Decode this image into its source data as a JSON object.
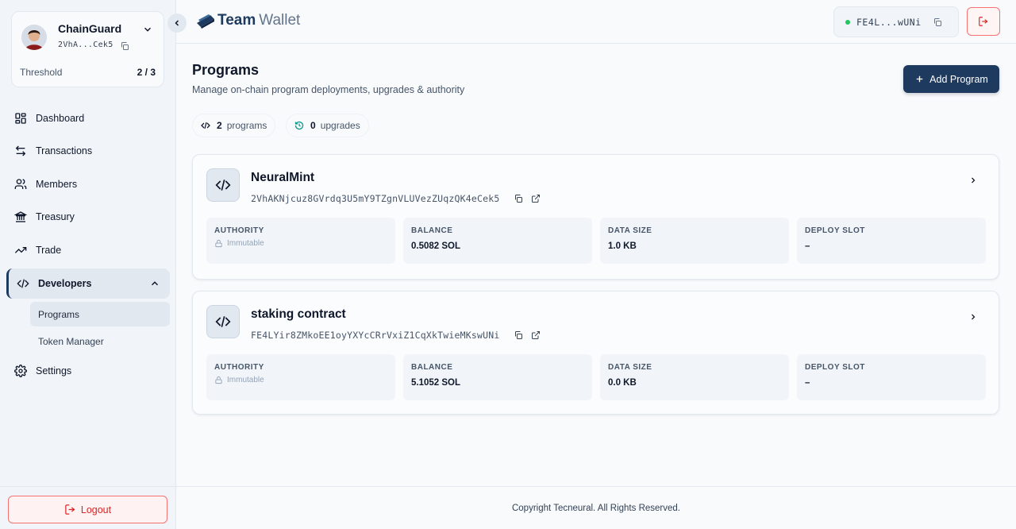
{
  "app": {
    "brand_bold": "Team",
    "brand_light": "Wallet"
  },
  "wallet": {
    "name": "ChainGuard",
    "address_short": "2VhA...Cek5",
    "threshold_label": "Threshold",
    "threshold_value": "2 / 3"
  },
  "nav": {
    "dashboard": "Dashboard",
    "transactions": "Transactions",
    "members": "Members",
    "treasury": "Treasury",
    "trade": "Trade",
    "developers": "Developers",
    "programs": "Programs",
    "token_manager": "Token Manager",
    "settings": "Settings",
    "logout": "Logout"
  },
  "header": {
    "address_short": "FE4L...wUNi",
    "status_color": "#22c55e"
  },
  "page": {
    "title": "Programs",
    "subtitle": "Manage on-chain program deployments, upgrades & authority",
    "add_button": "Add Program"
  },
  "stats": {
    "programs_count": "2",
    "programs_label": "programs",
    "upgrades_count": "0",
    "upgrades_label": "upgrades"
  },
  "labels": {
    "authority": "AUTHORITY",
    "balance": "BALANCE",
    "data_size": "DATA SIZE",
    "deploy_slot": "DEPLOY SLOT"
  },
  "programs": [
    {
      "name": "NeuralMint",
      "address": "2VhAKNjcuz8GVrdq3U5mY9TZgnVLUVezZUqzQK4eCek5",
      "authority": "Immutable",
      "balance": "0.5082 SOL",
      "data_size": "1.0 KB",
      "deploy_slot": "–"
    },
    {
      "name": "staking contract",
      "address": "FE4LYir8ZMkoEE1oyYXYcCRrVxiZ1CqXkTwieMKswUNi",
      "authority": "Immutable",
      "balance": "5.1052 SOL",
      "data_size": "0.0 KB",
      "deploy_slot": "–"
    }
  ],
  "footer": {
    "copyright": "Copyright Tecneural. All Rights Reserved."
  },
  "colors": {
    "primary": "#1e3a5f",
    "danger": "#dc2626",
    "success": "#22c55e"
  }
}
